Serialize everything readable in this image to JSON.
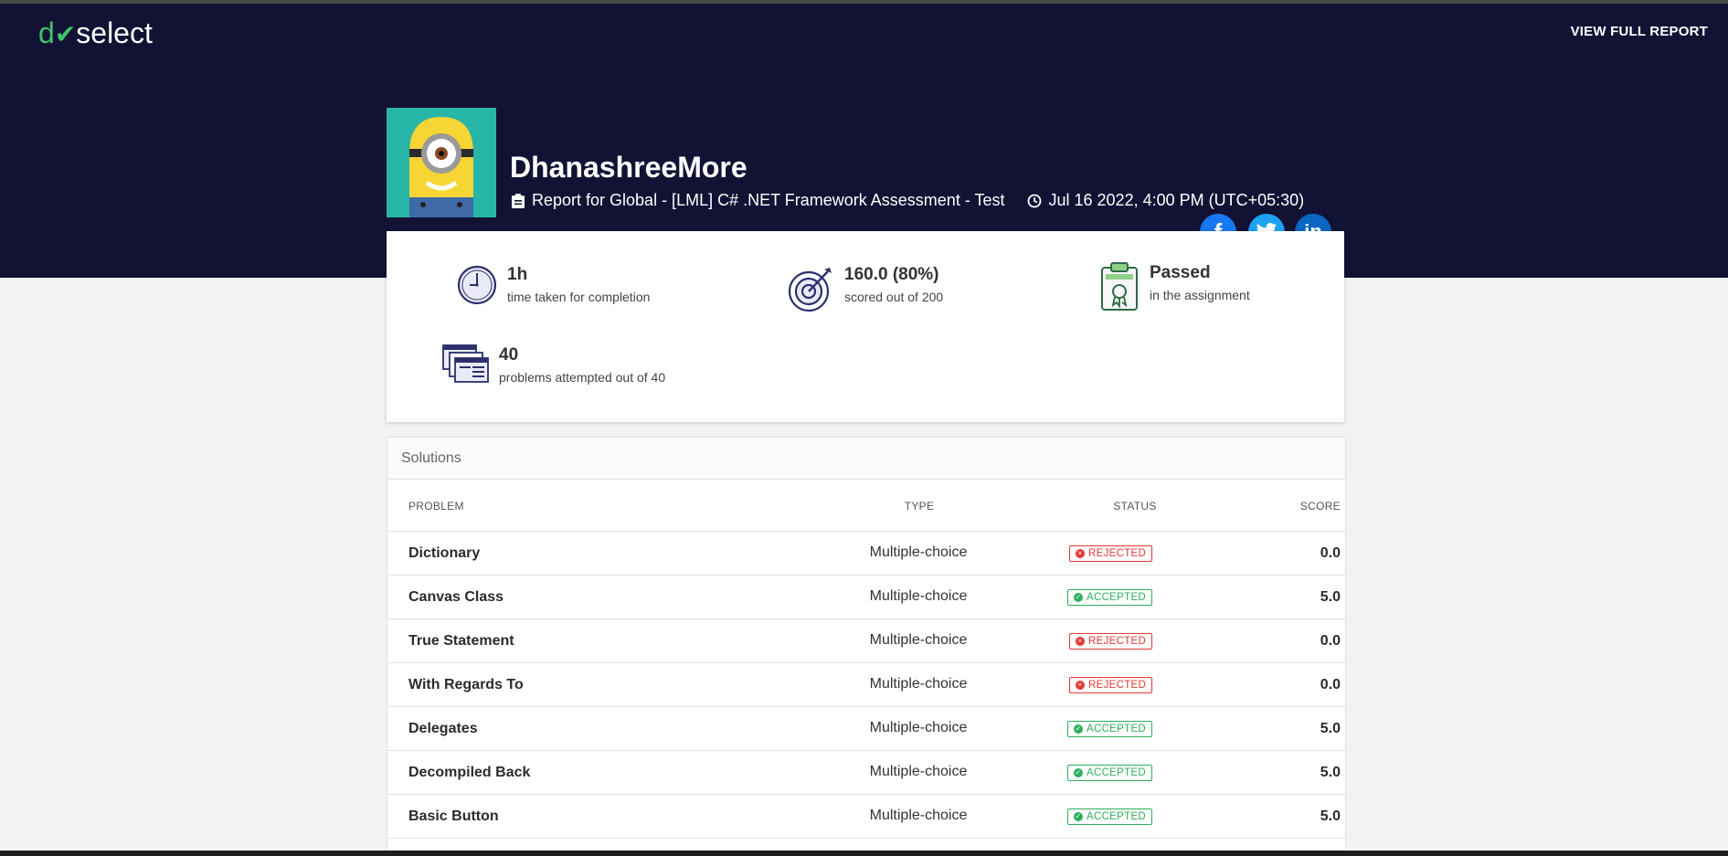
{
  "header": {
    "logo_do": "d",
    "logo_rest": "select",
    "view_full_report": "VIEW FULL REPORT",
    "username": "DhanashreeMore",
    "report_text": "Report for Global - [LML] C# .NET Framework Assessment - Test",
    "datetime": "Jul 16 2022, 4:00 PM (UTC+05:30)",
    "social": [
      "facebook",
      "twitter",
      "linkedin"
    ]
  },
  "stats": {
    "time": {
      "value": "1h",
      "label": "time taken for completion",
      "icon": "clock-icon"
    },
    "score": {
      "value": "160.0 (80%)",
      "label": "scored out of 200",
      "icon": "target-icon"
    },
    "result": {
      "value": "Passed",
      "label": "in the assignment",
      "icon": "certificate-icon"
    },
    "problems": {
      "value": "40",
      "label": "problems attempted out of 40",
      "icon": "documents-icon"
    }
  },
  "solutions": {
    "title": "Solutions",
    "columns": {
      "problem": "PROBLEM",
      "type": "TYPE",
      "status": "STATUS",
      "score": "SCORE"
    },
    "rows": [
      {
        "name": "Dictionary",
        "type": "Multiple-choice",
        "status": "REJECTED",
        "score": "0.0"
      },
      {
        "name": "Canvas Class",
        "type": "Multiple-choice",
        "status": "ACCEPTED",
        "score": "5.0"
      },
      {
        "name": "True Statement",
        "type": "Multiple-choice",
        "status": "REJECTED",
        "score": "0.0"
      },
      {
        "name": "With Regards To",
        "type": "Multiple-choice",
        "status": "REJECTED",
        "score": "0.0"
      },
      {
        "name": "Delegates",
        "type": "Multiple-choice",
        "status": "ACCEPTED",
        "score": "5.0"
      },
      {
        "name": "Decompiled Back",
        "type": "Multiple-choice",
        "status": "ACCEPTED",
        "score": "5.0"
      },
      {
        "name": "Basic Button",
        "type": "Multiple-choice",
        "status": "ACCEPTED",
        "score": "5.0"
      }
    ]
  },
  "colors": {
    "header_bg": "#121234",
    "brand_green": "#3fc26b",
    "rejected": "#e53935",
    "accepted": "#2eaf5a"
  }
}
